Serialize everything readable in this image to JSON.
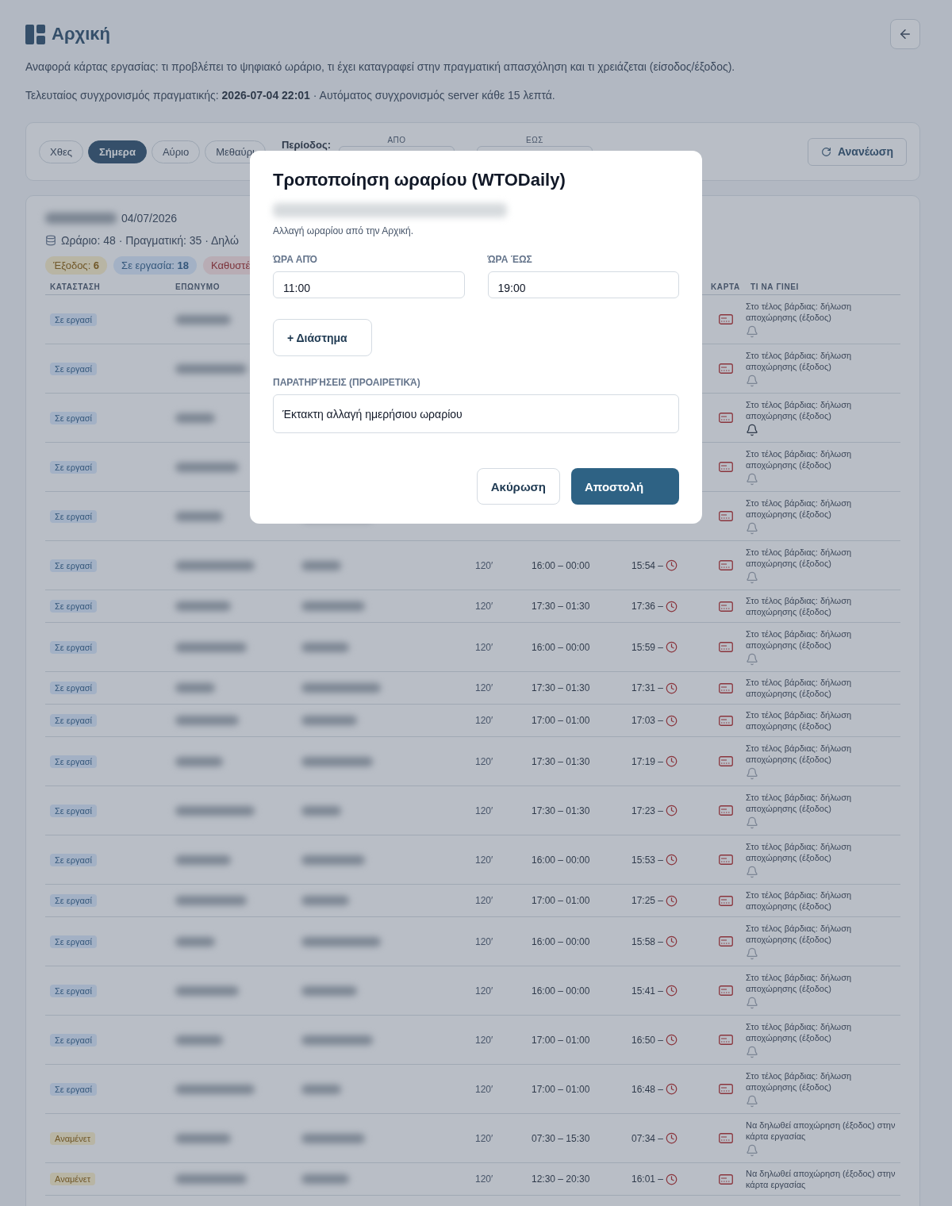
{
  "header": {
    "title": "Αρχική",
    "subtitle": "Αναφορά κάρτας εργασίας: τι προβλέπει το ψηφιακό ωράριο, τι έχει καταγραφεί στην πραγματική απασχόληση και τι χρειάζεται (είσοδος/έξοδος).",
    "sync": "Τελευταίος συγχρονισμός πραγματικής: **2026-07-04 22:01** · Αυτόματος συγχρονισμός server κάθε 15 λεπτά."
  },
  "filters": {
    "chips": [
      {
        "label": "Χθες",
        "selected": false
      },
      {
        "label": "Σήμερα",
        "selected": true
      },
      {
        "label": "Αύριο",
        "selected": false
      },
      {
        "label": "Μεθαύρι",
        "selected": false
      }
    ],
    "period_label": "Περίοδος:",
    "from_label": "ΑΠΟ",
    "to_label": "ΕΩΣ",
    "refresh": "Ανανέωση"
  },
  "summary": {
    "date": "04/07/2026",
    "stats": "Ωράριο: 48 · Πραγματική: 35 · Δηλώ",
    "badges": [
      {
        "kind": "exit",
        "text": "Έξοδος: **6**"
      },
      {
        "kind": "working",
        "text": "Σε εργασία: **18**"
      },
      {
        "kind": "late",
        "text": "Καθυστέ"
      }
    ]
  },
  "columns": {
    "status": "ΚΑΤΑΣΤΑΣΗ",
    "surname": "ΕΠΩΝΥΜΟ",
    "card": "ΚΑΡΤΑ",
    "action": "ΤΙ ΝΑ ΓΙΝΕΙ"
  },
  "rows": [
    {
      "kind": "working",
      "status": "Σε εργασί",
      "action": "Στο τέλος βάρδιας: δήλωση αποχώρησης (έξοδος)",
      "bell": true,
      "bell_active": false
    },
    {
      "kind": "working",
      "status": "Σε εργασί",
      "action": "Στο τέλος βάρδιας: δήλωση αποχώρησης (έξοδος)",
      "bell": true,
      "bell_active": false
    },
    {
      "kind": "working",
      "status": "Σε εργασί",
      "action": "Στο τέλος βάρδιας: δήλωση αποχώρησης (έξοδος)",
      "bell": true,
      "bell_active": true
    },
    {
      "kind": "working",
      "status": "Σε εργασί",
      "action": "Στο τέλος βάρδιας: δήλωση αποχώρησης (έξοδος)",
      "bell": true,
      "bell_active": false
    },
    {
      "kind": "working",
      "status": "Σε εργασί",
      "action": "Στο τέλος βάρδιας: δήλωση αποχώρησης (έξοδος)",
      "bell": true,
      "bell_active": false
    },
    {
      "kind": "working",
      "status": "Σε εργασί",
      "minutes": "120′",
      "shift": "16:00 – 00:00",
      "actual": "15:54 –",
      "action": "Στο τέλος βάρδιας: δήλωση αποχώρησης (έξοδος)",
      "bell": true,
      "bell_active": false
    },
    {
      "kind": "working",
      "status": "Σε εργασί",
      "minutes": "120′",
      "shift": "17:30 – 01:30",
      "actual": "17:36 –",
      "action": "Στο τέλος βάρδιας: δήλωση αποχώρησης (έξοδος)",
      "bell": false
    },
    {
      "kind": "working",
      "status": "Σε εργασί",
      "minutes": "120′",
      "shift": "16:00 – 00:00",
      "actual": "15:59 –",
      "action": "Στο τέλος βάρδιας: δήλωση αποχώρησης (έξοδος)",
      "bell": true,
      "bell_active": false
    },
    {
      "kind": "working",
      "status": "Σε εργασί",
      "minutes": "120′",
      "shift": "17:30 – 01:30",
      "actual": "17:31 –",
      "action": "Στο τέλος βάρδιας: δήλωση αποχώρησης (έξοδος)",
      "bell": false
    },
    {
      "kind": "working",
      "status": "Σε εργασί",
      "minutes": "120′",
      "shift": "17:00 – 01:00",
      "actual": "17:03 –",
      "action": "Στο τέλος βάρδιας: δήλωση αποχώρησης (έξοδος)",
      "bell": false
    },
    {
      "kind": "working",
      "status": "Σε εργασί",
      "minutes": "120′",
      "shift": "17:30 – 01:30",
      "actual": "17:19 –",
      "action": "Στο τέλος βάρδιας: δήλωση αποχώρησης (έξοδος)",
      "bell": true,
      "bell_active": false
    },
    {
      "kind": "working",
      "status": "Σε εργασί",
      "minutes": "120′",
      "shift": "17:30 – 01:30",
      "actual": "17:23 –",
      "action": "Στο τέλος βάρδιας: δήλωση αποχώρησης (έξοδος)",
      "bell": true,
      "bell_active": false
    },
    {
      "kind": "working",
      "status": "Σε εργασί",
      "minutes": "120′",
      "shift": "16:00 – 00:00",
      "actual": "15:53 –",
      "action": "Στο τέλος βάρδιας: δήλωση αποχώρησης (έξοδος)",
      "bell": true,
      "bell_active": false
    },
    {
      "kind": "working",
      "status": "Σε εργασί",
      "minutes": "120′",
      "shift": "17:00 – 01:00",
      "actual": "17:25 –",
      "action": "Στο τέλος βάρδιας: δήλωση αποχώρησης (έξοδος)",
      "bell": false
    },
    {
      "kind": "working",
      "status": "Σε εργασί",
      "minutes": "120′",
      "shift": "16:00 – 00:00",
      "actual": "15:58 –",
      "action": "Στο τέλος βάρδιας: δήλωση αποχώρησης (έξοδος)",
      "bell": true,
      "bell_active": false
    },
    {
      "kind": "working",
      "status": "Σε εργασί",
      "minutes": "120′",
      "shift": "16:00 – 00:00",
      "actual": "15:41 –",
      "action": "Στο τέλος βάρδιας: δήλωση αποχώρησης (έξοδος)",
      "bell": true,
      "bell_active": false
    },
    {
      "kind": "working",
      "status": "Σε εργασί",
      "minutes": "120′",
      "shift": "17:00 – 01:00",
      "actual": "16:50 –",
      "action": "Στο τέλος βάρδιας: δήλωση αποχώρησης (έξοδος)",
      "bell": true,
      "bell_active": false
    },
    {
      "kind": "working",
      "status": "Σε εργασί",
      "minutes": "120′",
      "shift": "17:00 – 01:00",
      "actual": "16:48 –",
      "action": "Στο τέλος βάρδιας: δήλωση αποχώρησης (έξοδος)",
      "bell": true,
      "bell_active": false
    },
    {
      "kind": "waiting",
      "status": "Αναμένετ",
      "minutes": "120′",
      "shift": "07:30 – 15:30",
      "actual": "07:34 –",
      "action": "Να δηλωθεί αποχώρηση (έξοδος) στην κάρτα εργασίας",
      "bell": true,
      "bell_active": false
    },
    {
      "kind": "waiting",
      "status": "Αναμένετ",
      "minutes": "120′",
      "shift": "12:30 – 20:30",
      "actual": "16:01 –",
      "action": "Να δηλωθεί αποχώρηση (έξοδος) στην κάρτα εργασίας",
      "bell": false
    }
  ],
  "modal": {
    "title": "Τροποποίηση ωραρίου (WTODaily)",
    "description": "Αλλαγή ωραρίου από την Αρχική.",
    "from_label": "ΏΡΑ ΑΠΌ",
    "from_value": "11:00",
    "to_label": "ΏΡΑ ΈΩΣ",
    "to_value": "19:00",
    "add_interval": "+ Διάστημα",
    "notes_label": "ΠΑΡΑΤΗΡΉΣΕΙΣ (ΠΡΟΑΙΡΕΤΙΚΆ)",
    "notes_value": "Έκτακτη αλλαγή ημερήσιου ωραρίου",
    "cancel": "Ακύρωση",
    "submit": "Αποστολή"
  }
}
